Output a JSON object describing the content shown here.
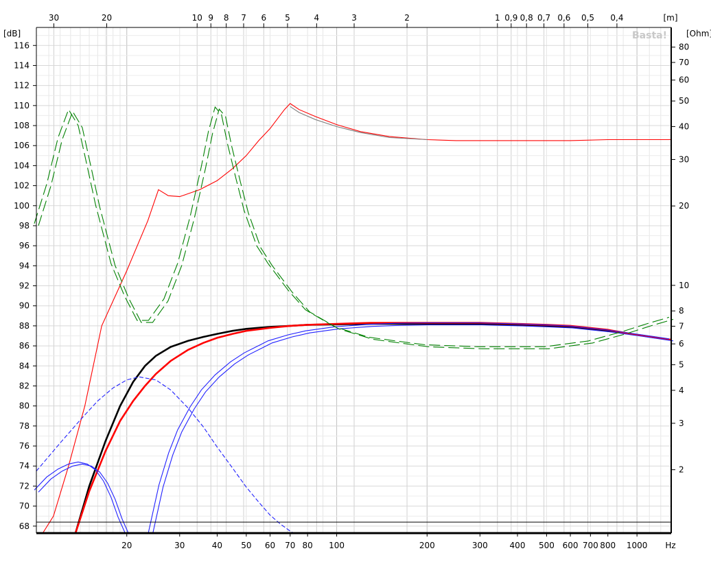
{
  "chart_data": {
    "type": "line",
    "watermark": "Basta!",
    "units": {
      "y_left": "[dB]",
      "y_right": "[Ohm]",
      "x_bottom": "Hz",
      "x_top": "[m]"
    },
    "x_bottom": {
      "scale": "log",
      "range": [
        10,
        1300
      ],
      "ticks": [
        20,
        30,
        40,
        50,
        60,
        70,
        80,
        100,
        200,
        300,
        400,
        500,
        600,
        700,
        800,
        1000
      ],
      "tick_labels": [
        "20",
        "30",
        "40",
        "50",
        "60",
        "70",
        "80",
        "100",
        "200",
        "300",
        "400",
        "500",
        "600",
        "700",
        "800",
        "1000"
      ]
    },
    "x_top": {
      "scale": "reciprocal",
      "quantity": "wavelength",
      "ticks": [
        30,
        20,
        10,
        9,
        8,
        7,
        6,
        5,
        4,
        3,
        2,
        1,
        0.9,
        0.8,
        0.7,
        0.6,
        0.5,
        0.4
      ],
      "tick_labels": [
        "30",
        "20",
        "10",
        "9",
        "8",
        "7",
        "6",
        "5",
        "4",
        "3",
        "2",
        "1",
        "0,9",
        "0,8",
        "0,7",
        "0,6",
        "0,5",
        "0,4"
      ]
    },
    "y_left": {
      "range": [
        67.3,
        117.8
      ],
      "ticks": [
        68,
        70,
        72,
        74,
        76,
        78,
        80,
        82,
        84,
        86,
        88,
        90,
        92,
        94,
        96,
        98,
        100,
        102,
        104,
        106,
        108,
        110,
        112,
        114,
        116
      ]
    },
    "y_right": {
      "scale": "log",
      "range": [
        1.15,
        95
      ],
      "ticks": [
        2,
        3,
        4,
        5,
        6,
        7,
        8,
        10,
        20,
        30,
        40,
        50,
        60,
        70,
        80
      ],
      "tick_labels": [
        "2",
        "3",
        "4",
        "5",
        "6",
        "7",
        "8",
        "10",
        "20",
        "30",
        "40",
        "50",
        "60",
        "70",
        "80"
      ]
    },
    "grid": true,
    "legend": "none",
    "reference_line_db": 68.4,
    "series": [
      {
        "axis": "left",
        "color": "#ff0000",
        "style": "thin",
        "x": [
          10.5,
          11.4,
          12.8,
          14.5,
          16.5,
          20,
          23.5,
          25.5,
          27.5,
          30,
          35,
          40,
          45,
          50,
          55,
          60,
          67,
          70,
          75,
          85,
          100,
          120,
          150,
          200,
          250,
          300,
          400,
          500,
          600,
          800,
          1000,
          1300
        ],
        "y": [
          67.3,
          69,
          74,
          80,
          88,
          93.5,
          98.5,
          101.6,
          101,
          100.9,
          101.6,
          102.5,
          103.7,
          105,
          106.5,
          107.7,
          109.6,
          110.2,
          109.6,
          108.9,
          108.1,
          107.4,
          106.9,
          106.6,
          106.5,
          106.5,
          106.5,
          106.5,
          106.5,
          106.6,
          106.6,
          106.6
        ]
      },
      {
        "axis": "left",
        "color": "#808080",
        "style": "thin",
        "x": [
          70,
          75,
          85,
          100,
          120,
          150,
          200
        ],
        "y": [
          109.9,
          109.3,
          108.6,
          107.9,
          107.3,
          106.8,
          106.6
        ]
      },
      {
        "axis": "left",
        "color": "#000000",
        "style": "bold",
        "x": [
          13.5,
          15,
          17,
          19,
          21,
          23,
          25,
          28,
          32,
          36,
          40,
          45,
          50,
          60,
          70,
          80,
          100,
          130,
          160,
          200,
          300,
          400,
          500,
          600,
          800,
          1000,
          1300
        ],
        "y": [
          67.3,
          72,
          76.5,
          80,
          82.4,
          84,
          85,
          85.9,
          86.5,
          86.9,
          87.2,
          87.5,
          87.7,
          87.9,
          88,
          88.1,
          88.15,
          88.2,
          88.2,
          88.2,
          88.2,
          88.1,
          88,
          87.9,
          87.5,
          87.1,
          86.6
        ]
      },
      {
        "axis": "left",
        "color": "#ff0000",
        "style": "bold",
        "x": [
          13.5,
          15,
          17,
          19,
          21,
          23,
          25,
          28,
          32,
          36,
          40,
          45,
          50,
          60,
          70,
          80,
          100,
          130,
          160,
          200,
          300,
          400,
          500,
          600,
          800,
          1000,
          1300
        ],
        "y": [
          67.3,
          71.5,
          75.5,
          78.5,
          80.5,
          82,
          83.2,
          84.5,
          85.6,
          86.3,
          86.8,
          87.2,
          87.5,
          87.8,
          88,
          88.1,
          88.2,
          88.3,
          88.3,
          88.3,
          88.3,
          88.2,
          88.1,
          88,
          87.6,
          87.1,
          86.6
        ]
      },
      {
        "axis": "left",
        "color": "#2020ff",
        "style": "double",
        "x": [
          24,
          26,
          28,
          30,
          33,
          36,
          40,
          45,
          50,
          60,
          70,
          80,
          100,
          130,
          160,
          200,
          300,
          400,
          500,
          600,
          800,
          1000,
          1300
        ],
        "y": [
          67.3,
          72,
          75.2,
          77.5,
          79.8,
          81.5,
          83,
          84.3,
          85.2,
          86.4,
          87,
          87.4,
          87.8,
          88.05,
          88.15,
          88.2,
          88.2,
          88.1,
          88,
          87.9,
          87.5,
          87.1,
          86.6
        ]
      },
      {
        "axis": "left",
        "color": "#2020ff",
        "style": "double",
        "x": [
          10,
          11,
          12,
          13,
          14,
          15,
          16,
          17,
          18,
          19,
          20
        ],
        "y": [
          71.5,
          72.8,
          73.6,
          74.1,
          74.3,
          74.1,
          73.5,
          72.4,
          70.8,
          68.8,
          67.3
        ]
      },
      {
        "axis": "left",
        "color": "#2020ff",
        "style": "dashed",
        "x": [
          10,
          12,
          14,
          16,
          18,
          20,
          22,
          25,
          28,
          32,
          36,
          40,
          45,
          50,
          55,
          60,
          65,
          70,
          72
        ],
        "y": [
          73.5,
          76.3,
          78.6,
          80.5,
          81.8,
          82.6,
          82.9,
          82.6,
          81.6,
          79.8,
          77.9,
          75.9,
          73.8,
          71.9,
          70.4,
          69.1,
          68.2,
          67.5,
          67.3
        ]
      },
      {
        "axis": "right",
        "color": "#008000",
        "style": "dashed-double",
        "x": [
          10,
          11,
          12,
          13,
          14,
          15,
          16,
          18,
          20,
          22,
          24,
          27,
          30,
          33,
          36,
          38,
          40,
          42,
          44,
          47,
          50,
          55,
          60,
          70,
          80,
          100,
          130,
          160,
          200,
          300,
          500,
          700,
          900,
          1100,
          1300
        ],
        "y": [
          17,
          24,
          36,
          46,
          40,
          28,
          20,
          12,
          9,
          7.3,
          7.3,
          8.8,
          12,
          18,
          28,
          38,
          47,
          44,
          34,
          25,
          19,
          14,
          12,
          9.5,
          8,
          6.9,
          6.3,
          6.1,
          5.9,
          5.8,
          5.8,
          6.1,
          6.6,
          7.1,
          7.5
        ]
      }
    ]
  }
}
